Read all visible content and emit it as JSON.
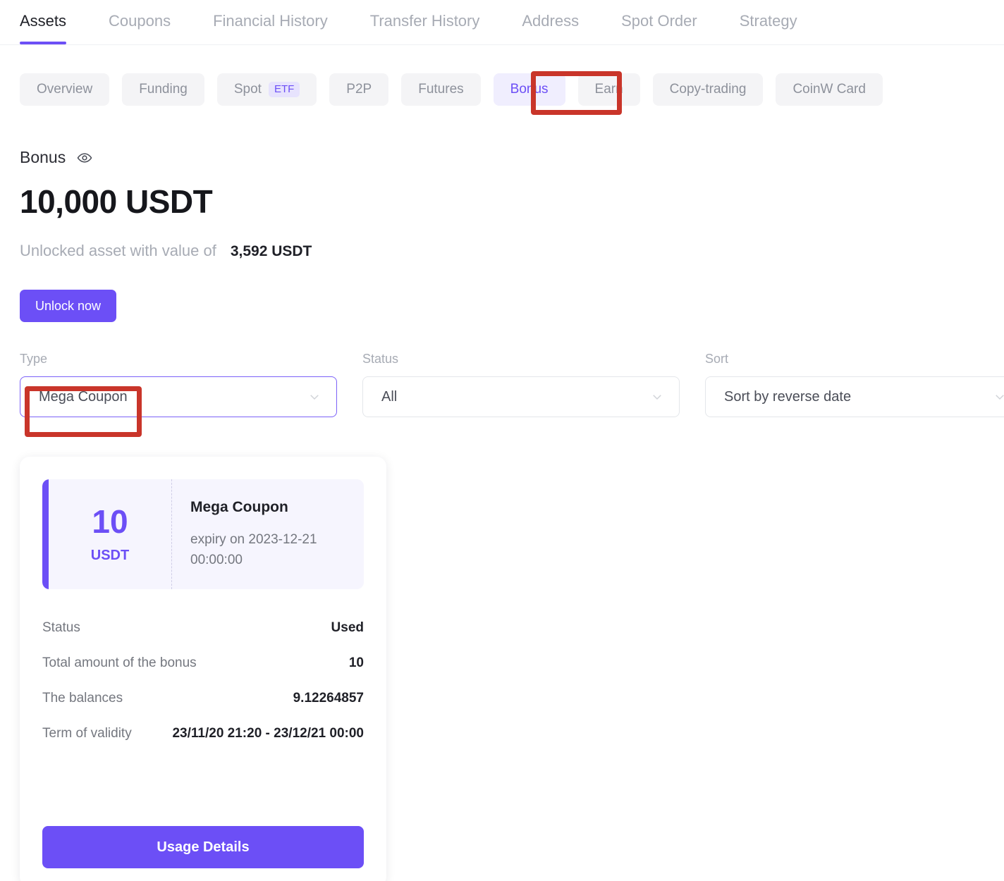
{
  "main_tabs": [
    {
      "label": "Assets",
      "active": true
    },
    {
      "label": "Coupons",
      "active": false
    },
    {
      "label": "Financial History",
      "active": false
    },
    {
      "label": "Transfer History",
      "active": false
    },
    {
      "label": "Address",
      "active": false
    },
    {
      "label": "Spot Order",
      "active": false
    },
    {
      "label": "Strategy",
      "active": false
    }
  ],
  "sub_tabs": [
    {
      "label": "Overview",
      "badge": "",
      "selected": false
    },
    {
      "label": "Funding",
      "badge": "",
      "selected": false
    },
    {
      "label": "Spot",
      "badge": "ETF",
      "selected": false
    },
    {
      "label": "P2P",
      "badge": "",
      "selected": false
    },
    {
      "label": "Futures",
      "badge": "",
      "selected": false
    },
    {
      "label": "Bonus",
      "badge": "",
      "selected": true
    },
    {
      "label": "Earn",
      "badge": "",
      "selected": false
    },
    {
      "label": "Copy-trading",
      "badge": "",
      "selected": false
    },
    {
      "label": "CoinW Card",
      "badge": "",
      "selected": false
    }
  ],
  "bonus": {
    "title": "Bonus",
    "visibility_icon": "eye-icon",
    "amount": "10,000 USDT",
    "unlocked_prefix": "Unlocked asset with value of",
    "unlocked_value": "3,592 USDT",
    "unlock_button": "Unlock now"
  },
  "filters": {
    "type": {
      "label": "Type",
      "value": "Mega Coupon"
    },
    "status": {
      "label": "Status",
      "value": "All"
    },
    "sort": {
      "label": "Sort",
      "value": "Sort by reverse date"
    }
  },
  "coupon_card": {
    "amount": "10",
    "currency": "USDT",
    "name": "Mega Coupon",
    "expiry": "expiry on 2023-12-21 00:00:00",
    "details": [
      {
        "label": "Status",
        "value": "Used"
      },
      {
        "label": "Total amount of the bonus",
        "value": "10"
      },
      {
        "label": "The balances",
        "value": "9.12264857"
      },
      {
        "label": "Term of validity",
        "value": "23/11/20 21:20 - 23/12/21 00:00"
      }
    ],
    "action_button": "Usage Details"
  },
  "colors": {
    "accent_purple": "#6c4ff6",
    "annotation_red": "#c9352a",
    "badge_bg": "#e7e3fd",
    "ticket_bg": "#f6f5fe"
  }
}
